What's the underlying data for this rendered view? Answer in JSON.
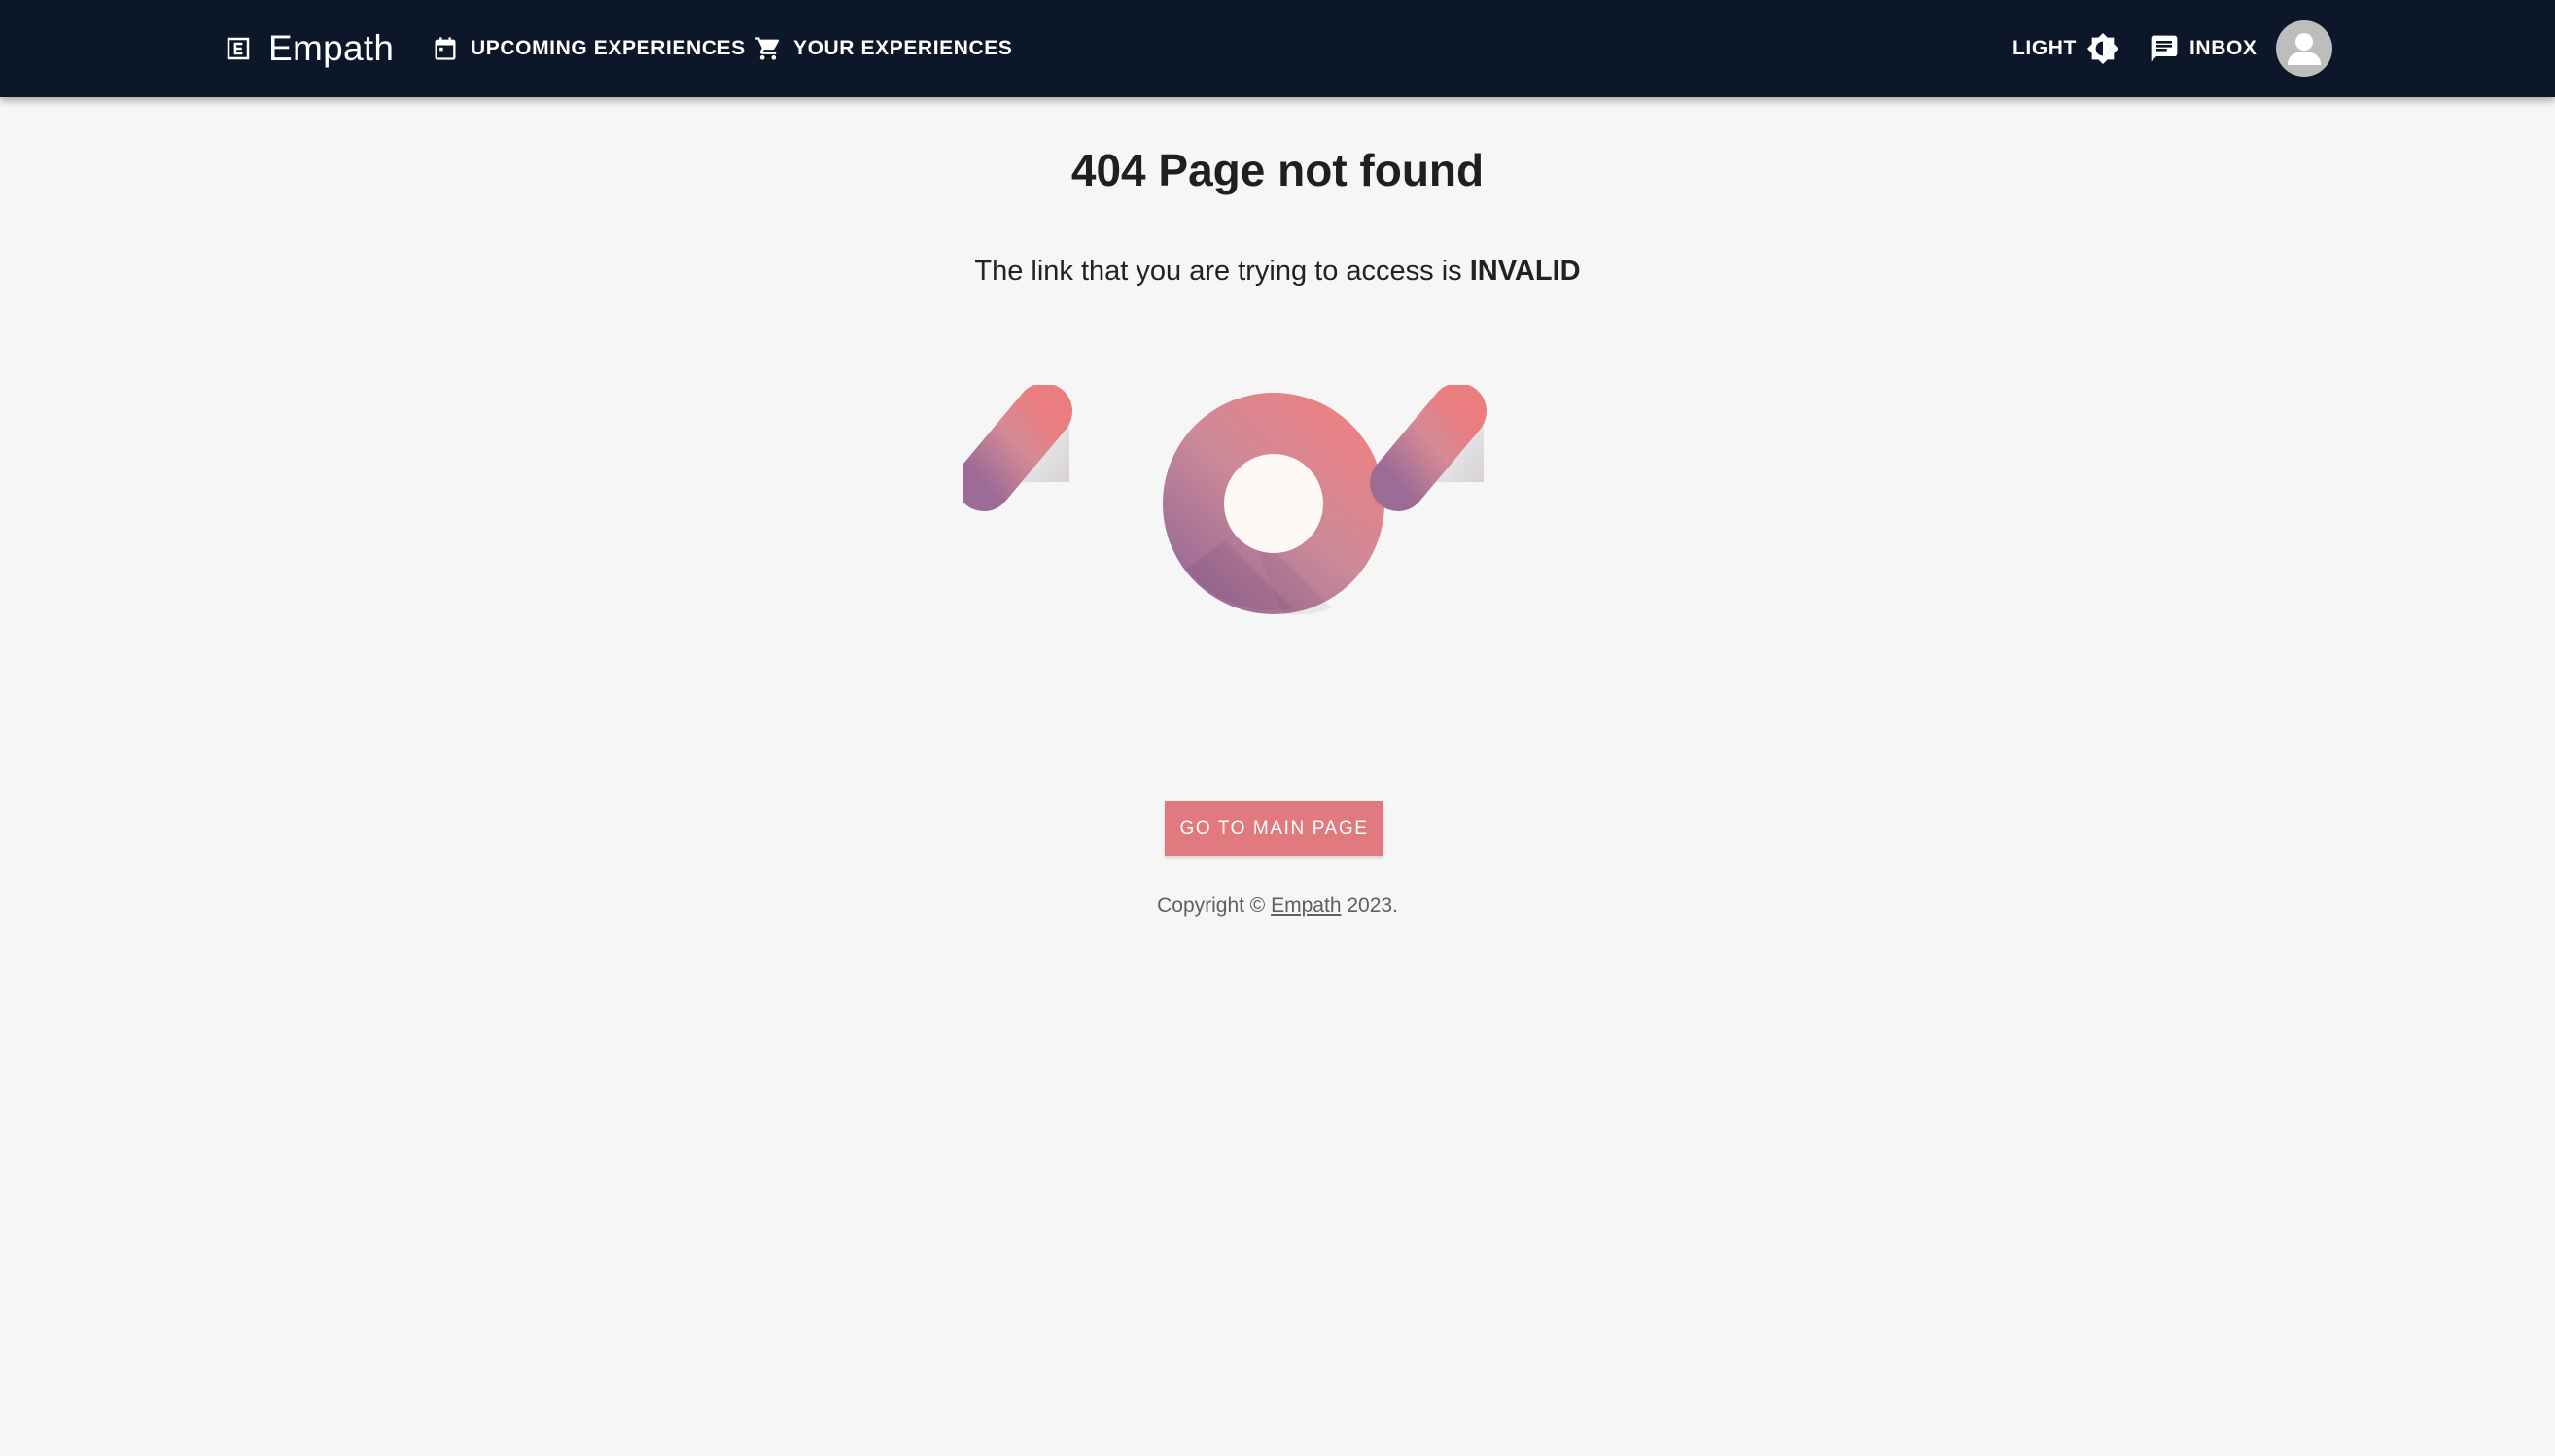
{
  "brand": {
    "name": "Empath",
    "icon": "e-logo-icon"
  },
  "nav": {
    "upcoming_label": "UPCOMING EXPERIENCES",
    "upcoming_icon": "calendar-icon",
    "yours_label": "YOUR EXPERIENCES",
    "yours_icon": "cart-icon",
    "theme_label": "LIGHT",
    "theme_icon": "brightness-icon",
    "inbox_label": "INBOX",
    "inbox_icon": "chat-icon",
    "avatar_icon": "person-icon"
  },
  "main": {
    "title": "404 Page not found",
    "subtitle_prefix": "The link that you are trying to access is ",
    "subtitle_emphasis": "INVALID",
    "illustration": "404-graphic",
    "cta_label": "GO TO MAIN PAGE"
  },
  "footer": {
    "copyright_prefix": "Copyright © ",
    "copyright_link": "Empath",
    "copyright_suffix": " 2023."
  },
  "colors": {
    "appbar_bg": "#0c1829",
    "page_bg": "#f6f6f6",
    "accent": "#e07a7e",
    "gradient_pink": "#e97c80",
    "gradient_purple": "#9c6c96"
  }
}
